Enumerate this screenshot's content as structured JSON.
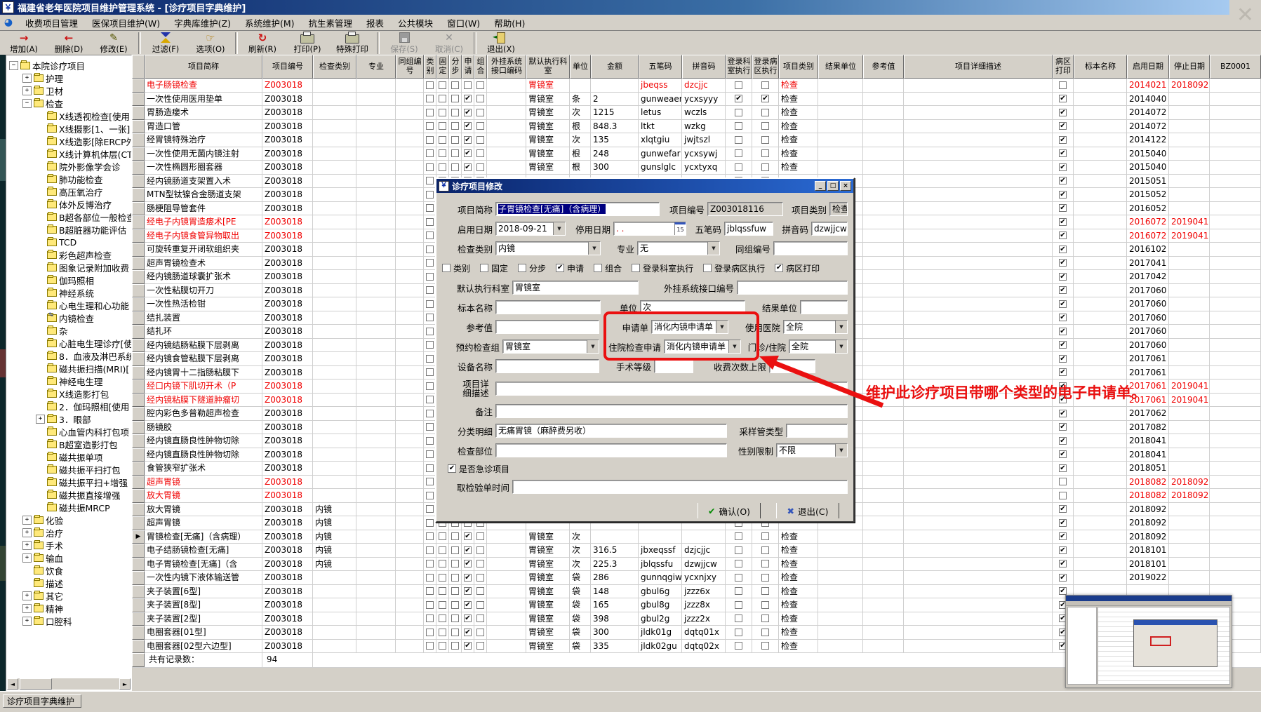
{
  "window": {
    "title": "福建省老年医院项目维护管理系统  -  [诊疗项目字典维护]",
    "app_icon": "￥",
    "close_glyph": "✕"
  },
  "menubar": {
    "items": [
      "收费项目管理",
      "医保项目维护(W)",
      "字典库维护(Z)",
      "系统维护(M)",
      "抗生素管理",
      "报表",
      "公共模块",
      "窗口(W)",
      "帮助(H)"
    ]
  },
  "toolbar": {
    "buttons": [
      {
        "id": "add",
        "label": "增加(A)",
        "enabled": true
      },
      {
        "id": "delete",
        "label": "删除(D)",
        "enabled": true
      },
      {
        "id": "modify",
        "label": "修改(E)",
        "enabled": true
      },
      {
        "id": "filter",
        "label": "过滤(F)",
        "enabled": true
      },
      {
        "id": "options",
        "label": "选项(O)",
        "enabled": true
      },
      {
        "id": "refresh",
        "label": "刷新(R)",
        "enabled": true
      },
      {
        "id": "print",
        "label": "打印(P)",
        "enabled": true
      },
      {
        "id": "special-print",
        "label": "特殊打印",
        "enabled": true
      },
      {
        "id": "save",
        "label": "保存(S)",
        "enabled": false
      },
      {
        "id": "cancel",
        "label": "取消(C)",
        "enabled": false
      },
      {
        "id": "exit",
        "label": "退出(X)",
        "enabled": true
      }
    ]
  },
  "tree": {
    "items": [
      {
        "t": "本院诊疗项目",
        "l": 0,
        "b": "-",
        "i": "f"
      },
      {
        "t": "护理",
        "l": 1,
        "b": "+",
        "i": "f"
      },
      {
        "t": "卫材",
        "l": 1,
        "b": "+",
        "i": "f"
      },
      {
        "t": "检查",
        "l": 1,
        "b": "-",
        "i": "f"
      },
      {
        "t": "X线透视检查[使用",
        "l": 2,
        "b": null,
        "i": "f"
      },
      {
        "t": "X线摄影[1、一张]",
        "l": 2,
        "b": null,
        "i": "f"
      },
      {
        "t": "X线造影[除ERCP外",
        "l": 2,
        "b": null,
        "i": "f"
      },
      {
        "t": "X线计算机体层(CT",
        "l": 2,
        "b": null,
        "i": "f"
      },
      {
        "t": "院外影像学会诊",
        "l": 2,
        "b": null,
        "i": "f"
      },
      {
        "t": "肺功能检查",
        "l": 2,
        "b": null,
        "i": "f"
      },
      {
        "t": "高压氧治疗",
        "l": 2,
        "b": null,
        "i": "f"
      },
      {
        "t": "体外反博治疗",
        "l": 2,
        "b": null,
        "i": "f"
      },
      {
        "t": "B超各部位一般检查",
        "l": 2,
        "b": null,
        "i": "f"
      },
      {
        "t": "B超脏器功能评估",
        "l": 2,
        "b": null,
        "i": "f"
      },
      {
        "t": "TCD",
        "l": 2,
        "b": null,
        "i": "f"
      },
      {
        "t": "彩色超声检查",
        "l": 2,
        "b": null,
        "i": "f"
      },
      {
        "t": "图象记录附加收费",
        "l": 2,
        "b": null,
        "i": "f"
      },
      {
        "t": "伽玛照相",
        "l": 2,
        "b": null,
        "i": "f"
      },
      {
        "t": "神经系统",
        "l": 2,
        "b": null,
        "i": "f"
      },
      {
        "t": "心电生理和心功能",
        "l": 2,
        "b": null,
        "i": "f"
      },
      {
        "t": "内镜检查",
        "l": 2,
        "b": null,
        "i": "e"
      },
      {
        "t": "杂",
        "l": 2,
        "b": null,
        "i": "f"
      },
      {
        "t": "心脏电生理诊疗[使",
        "l": 2,
        "b": null,
        "i": "f"
      },
      {
        "t": "8．血液及淋巴系统",
        "l": 2,
        "b": null,
        "i": "f"
      },
      {
        "t": "磁共振扫描(MRI)[",
        "l": 2,
        "b": null,
        "i": "f"
      },
      {
        "t": "神经电生理",
        "l": 2,
        "b": null,
        "i": "f"
      },
      {
        "t": "X线造影打包",
        "l": 2,
        "b": null,
        "i": "f"
      },
      {
        "t": "2．伽玛照相[使用",
        "l": 2,
        "b": null,
        "i": "f"
      },
      {
        "t": "3．眼部",
        "l": 2,
        "b": "+",
        "i": "f"
      },
      {
        "t": "心血管内科打包项",
        "l": 2,
        "b": null,
        "i": "f"
      },
      {
        "t": "B超室造影打包",
        "l": 2,
        "b": null,
        "i": "f"
      },
      {
        "t": "磁共振单项",
        "l": 2,
        "b": null,
        "i": "f"
      },
      {
        "t": "磁共振平扫打包",
        "l": 2,
        "b": null,
        "i": "f"
      },
      {
        "t": "磁共振平扫+增强",
        "l": 2,
        "b": null,
        "i": "f"
      },
      {
        "t": "磁共振直接增强",
        "l": 2,
        "b": null,
        "i": "f"
      },
      {
        "t": "磁共振MRCP",
        "l": 2,
        "b": null,
        "i": "f"
      },
      {
        "t": "化验",
        "l": 1,
        "b": "+",
        "i": "f"
      },
      {
        "t": "治疗",
        "l": 1,
        "b": "+",
        "i": "f"
      },
      {
        "t": "手术",
        "l": 1,
        "b": "+",
        "i": "f"
      },
      {
        "t": "输血",
        "l": 1,
        "b": "+",
        "i": "f"
      },
      {
        "t": "饮食",
        "l": 1,
        "b": null,
        "i": "f"
      },
      {
        "t": "描述",
        "l": 1,
        "b": null,
        "i": "f"
      },
      {
        "t": "其它",
        "l": 1,
        "b": "+",
        "i": "f"
      },
      {
        "t": "精神",
        "l": 1,
        "b": "+",
        "i": "f"
      },
      {
        "t": "口腔科",
        "l": 1,
        "b": "+",
        "i": "f"
      }
    ]
  },
  "table": {
    "headers": [
      "项目简称",
      "项目编号",
      "检查类别",
      "专业",
      "同组编号",
      "类别",
      "固定",
      "分步",
      "申请",
      "组合",
      "外挂系统接口编码",
      "默认执行科室",
      "单位",
      "金额",
      "五笔码",
      "拼音码",
      "登录科室执行",
      "登录病区执行",
      "项目类别",
      "结果单位",
      "参考值",
      "项目详细描述",
      "病区打印",
      "标本名称",
      "启用日期",
      "停止日期",
      "BZ0001"
    ],
    "rows": [
      {
        "name": "电子肠镜检查",
        "code": "Z003018",
        "red": true,
        "dept": "胃镜室",
        "wb": "jbeqss",
        "py": "dzcjjc",
        "type": "检查",
        "wp": false,
        "start": "2014021",
        "stop": "2018092"
      },
      {
        "name": "一次性使用医用垫单",
        "code": "Z003018",
        "sq": true,
        "dept": "胃镜室",
        "unit": "条",
        "amt": "2",
        "wb": "gunweaer",
        "py": "ycxsyyy",
        "de": true,
        "we": true,
        "type": "检查",
        "wp": true,
        "start": "2014040"
      },
      {
        "name": "胃肠造瘘术",
        "code": "Z003018",
        "sq": true,
        "dept": "胃镜室",
        "unit": "次",
        "amt": "1215",
        "wb": "letus",
        "py": "wczls",
        "type": "检查",
        "wp": true,
        "start": "2014072"
      },
      {
        "name": "胃造口管",
        "code": "Z003018",
        "sq": true,
        "dept": "胃镜室",
        "unit": "根",
        "amt": "848.3",
        "wb": "ltkt",
        "py": "wzkg",
        "type": "检查",
        "wp": true,
        "start": "2014072"
      },
      {
        "name": "经胃镜特殊治疗",
        "code": "Z003018",
        "sq": true,
        "dept": "胃镜室",
        "unit": "次",
        "amt": "135",
        "wb": "xlqtgiu",
        "py": "jwjtszl",
        "type": "检查",
        "wp": true,
        "start": "2014122"
      },
      {
        "name": "一次性使用无菌内镜注射",
        "code": "Z003018",
        "sq": true,
        "dept": "胃镜室",
        "unit": "根",
        "amt": "248",
        "wb": "gunwefar",
        "py": "ycxsywj",
        "type": "检查",
        "wp": true,
        "start": "2015040"
      },
      {
        "name": "一次性椭圆形圈套器",
        "code": "Z003018",
        "sq": true,
        "dept": "胃镜室",
        "unit": "根",
        "amt": "300",
        "wb": "gunslglc",
        "py": "ycxtyxq",
        "type": "检查",
        "wp": true,
        "start": "2015040"
      },
      {
        "name": "经内镜肠道支架置入术",
        "code": "Z003018",
        "wp": true,
        "start": "2015051"
      },
      {
        "name": "MTN型钛镍合金肠道支架",
        "code": "Z003018",
        "wp": true,
        "start": "2015052"
      },
      {
        "name": "肠梗阻导管套件",
        "code": "Z003018",
        "wp": true,
        "start": "2016052"
      },
      {
        "name": "经电子内镜胃造瘘术[PE",
        "code": "Z003018",
        "red": true,
        "wp": true,
        "start": "2016072",
        "stop": "2019041"
      },
      {
        "name": "经电子内镜食管异物取出",
        "code": "Z003018",
        "red": true,
        "wp": true,
        "start": "2016072",
        "stop": "2019041"
      },
      {
        "name": "可旋转重复开闭软组织夹",
        "code": "Z003018",
        "wp": true,
        "start": "2016102"
      },
      {
        "name": "超声胃镜检查术",
        "code": "Z003018",
        "wp": true,
        "start": "2017041"
      },
      {
        "name": "经内镜肠道球囊扩张术",
        "code": "Z003018",
        "wp": true,
        "start": "2017042"
      },
      {
        "name": "一次性粘膜切开刀",
        "code": "Z003018",
        "wp": true,
        "start": "2017060"
      },
      {
        "name": "一次性热活检钳",
        "code": "Z003018",
        "wp": true,
        "start": "2017060"
      },
      {
        "name": "结扎装置",
        "code": "Z003018",
        "wp": true,
        "start": "2017060"
      },
      {
        "name": "结扎环",
        "code": "Z003018",
        "wp": true,
        "start": "2017060"
      },
      {
        "name": "经内镜结肠粘膜下层剥离",
        "code": "Z003018",
        "wp": true,
        "start": "2017060"
      },
      {
        "name": "经内镜食管粘膜下层剥离",
        "code": "Z003018",
        "wp": true,
        "start": "2017061"
      },
      {
        "name": "经内镜胃十二指肠粘膜下",
        "code": "Z003018",
        "wp": true,
        "start": "2017061"
      },
      {
        "name": "经口内镜下肌切开术（P",
        "code": "Z003018",
        "red": true,
        "wp": true,
        "start": "2017061",
        "stop": "2019041"
      },
      {
        "name": "经内镜粘膜下隧道肿瘤切",
        "code": "Z003018",
        "red": true,
        "wp": true,
        "start": "2017061",
        "stop": "2019041"
      },
      {
        "name": "腔内彩色多普勒超声检查",
        "code": "Z003018",
        "wp": true,
        "start": "2017062"
      },
      {
        "name": "肠镜胶",
        "code": "Z003018",
        "wp": true,
        "start": "2017082"
      },
      {
        "name": "经内镜直肠良性肿物切除",
        "code": "Z003018",
        "wp": true,
        "start": "2018041"
      },
      {
        "name": "经内镜直肠良性肿物切除",
        "code": "Z003018",
        "wp": true,
        "start": "2018041"
      },
      {
        "name": "食管狭窄扩张术",
        "code": "Z003018",
        "wp": true,
        "start": "2018051"
      },
      {
        "name": "超声胃镜",
        "code": "Z003018",
        "red": true,
        "wp": false,
        "start": "2018082",
        "stop": "2018092"
      },
      {
        "name": "放大胃镜",
        "code": "Z003018",
        "red": true,
        "wp": false,
        "start": "2018082",
        "stop": "2018092"
      },
      {
        "name": "放大胃镜",
        "code": "Z003018",
        "cls": "内镜",
        "wp": true,
        "start": "2018092"
      },
      {
        "name": "超声胃镜",
        "code": "Z003018",
        "cls": "内镜",
        "wp": true,
        "start": "2018092"
      },
      {
        "name": "胃镜检查[无痛]（含病理）",
        "code": "Z003018",
        "cls": "内镜",
        "cur": true,
        "sq": true,
        "dept": "胃镜室",
        "unit": "次",
        "type": "检查",
        "wp": true,
        "start": "2018092"
      },
      {
        "name": "电子结肠镜检查[无痛]",
        "code": "Z003018",
        "cls": "内镜",
        "sq": true,
        "dept": "胃镜室",
        "unit": "次",
        "amt": "316.5",
        "wb": "jbxeqssf",
        "py": "dzjcjjc",
        "type": "检查",
        "wp": true,
        "start": "2018101"
      },
      {
        "name": "电子胃镜检查[无痛]（含",
        "code": "Z003018",
        "cls": "内镜",
        "sq": true,
        "dept": "胃镜室",
        "unit": "次",
        "amt": "225.3",
        "wb": "jblqssfu",
        "py": "dzwjjcw",
        "type": "检查",
        "wp": true,
        "start": "2018101"
      },
      {
        "name": "一次性内镜下液体输送管",
        "code": "Z003018",
        "sq": true,
        "dept": "胃镜室",
        "unit": "袋",
        "amt": "286",
        "wb": "gunnqgiw",
        "py": "ycxnjxy",
        "type": "检查",
        "wp": true,
        "start": "2019022"
      },
      {
        "name": "夹子装置[6型]",
        "code": "Z003018",
        "sq": true,
        "dept": "胃镜室",
        "unit": "袋",
        "amt": "148",
        "wb": "gbul6g",
        "py": "jzzz6x",
        "type": "检查",
        "wp": true,
        "start": ""
      },
      {
        "name": "夹子装置[8型]",
        "code": "Z003018",
        "sq": true,
        "dept": "胃镜室",
        "unit": "袋",
        "amt": "165",
        "wb": "gbul8g",
        "py": "jzzz8x",
        "type": "检查",
        "wp": true,
        "start": ""
      },
      {
        "name": "夹子装置[2型]",
        "code": "Z003018",
        "sq": true,
        "dept": "胃镜室",
        "unit": "袋",
        "amt": "398",
        "wb": "gbul2g",
        "py": "jzzz2x",
        "type": "检查",
        "wp": true,
        "start": ""
      },
      {
        "name": "电圈套器[01型]",
        "code": "Z003018",
        "sq": true,
        "dept": "胃镜室",
        "unit": "袋",
        "amt": "300",
        "wb": "jldk01g",
        "py": "dqtq01x",
        "type": "检查",
        "wp": true,
        "start": ""
      },
      {
        "name": "电圈套器[02型六边型]",
        "code": "Z003018",
        "sq": true,
        "dept": "胃镜室",
        "unit": "袋",
        "amt": "335",
        "wb": "jldk02gu",
        "py": "dqtq02x",
        "type": "检查",
        "wp": true,
        "start": ""
      }
    ],
    "footer_label": "共有记录数：",
    "footer_count": "94"
  },
  "dialog": {
    "title": "诊疗项目修改",
    "titlebar_buttons": {
      "min": "_",
      "max": "□",
      "close": "×"
    },
    "labels": {
      "jc": "项目简称",
      "bh": "项目编号",
      "lb": "项目类别",
      "qy": "启用日期",
      "ty": "停用日期",
      "wb": "五笔码",
      "py": "拼音码",
      "jclb": "检查类别",
      "zy": "专业",
      "tz": "同组编号",
      "cb_lb": "类别",
      "cb_gd": "固定",
      "cb_fb": "分步",
      "cb_sq": "申请",
      "cb_zh": "组合",
      "cb_dk": "登录科室执行",
      "cb_db": "登录病区执行",
      "cb_bq": "病区打印",
      "mr": "默认执行科室",
      "wg": "外挂系统接口编号",
      "bb": "标本名称",
      "dw": "单位",
      "jg": "结果单位",
      "ck": "参考值",
      "sqd": "申请单",
      "syyy": "使用医院",
      "yy": "预约检查组",
      "zysq": "住院检查申请",
      "mz": "门诊/住院",
      "sb": "设备名称",
      "ss": "手术等级",
      "sf": "收费次数上限",
      "xm": "项目详细描述",
      "bz": "备注",
      "fl": "分类明细",
      "cy": "采样管类型",
      "jcbw": "检查部位",
      "xb": "性别限制",
      "jz": "是否急诊项目",
      "qj": "取检验单时间"
    },
    "values": {
      "jc": "子胃镜检查[无痛]（含病理）",
      "bh": "Z003018116",
      "lb": "检查",
      "qy": "2018-09-21",
      "ty": "  .    .",
      "cal": "15",
      "wb": "jblqssfuw",
      "py": "dzwjjcwth",
      "jclb": "内镜",
      "zy": "无",
      "tz": "",
      "mr": "胃镜室",
      "wg": "",
      "bb": "",
      "dw": "次",
      "jg": "",
      "ck": "",
      "sqd": "消化内镜申请单",
      "syyy": "全院",
      "yy": "胃镜室",
      "zysq": "消化内镜申请单",
      "mz": "全院",
      "sb": "",
      "ss": "",
      "sf": "",
      "xm": "",
      "bz": "",
      "fl": "无痛胃镜（麻醉费另收）",
      "cy": "",
      "jcbw": "",
      "xb": "不限",
      "qj": ""
    },
    "checks": {
      "lb": false,
      "gd": false,
      "fb": false,
      "sq": true,
      "zh": false,
      "dk": false,
      "db": false,
      "bq": true,
      "jz": true
    },
    "buttons": {
      "ok": "确认(O)",
      "exit": "退出(C)"
    }
  },
  "annotation": {
    "text": "维护此诊疗项目带哪个类型的电子申请单。",
    "color": "#ea1010"
  },
  "statusbar": {
    "tab": "诊疗项目字典维护"
  },
  "colors": {
    "red_row": "#f00000",
    "titlebar_left": "#0a246a",
    "titlebar_right": "#a6caf0",
    "annotation_red": "#ea1010",
    "selection": "#000080"
  }
}
